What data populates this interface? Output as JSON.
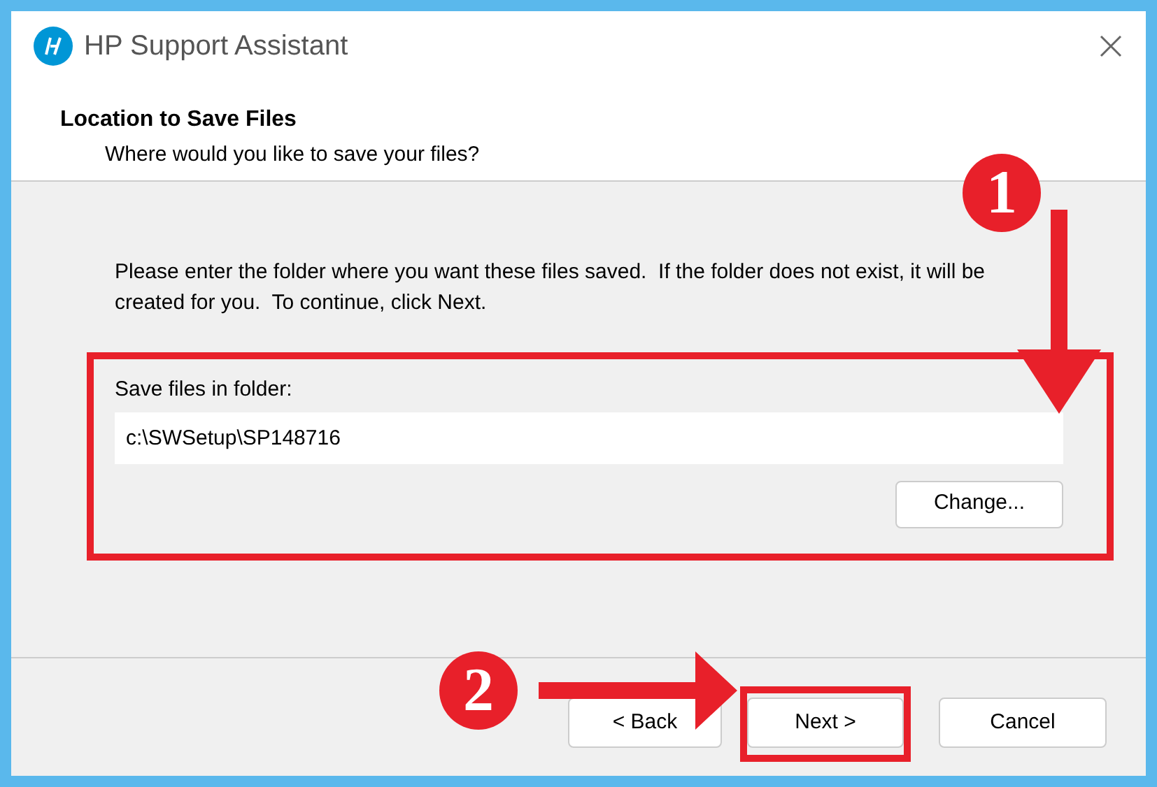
{
  "window": {
    "title": "HP Support Assistant"
  },
  "header": {
    "title": "Location to Save Files",
    "subtitle": "Where would you like to save your files?"
  },
  "instructions": "Please enter the folder where you want these files saved.  If the folder does not exist, it will be created for you.  To continue, click Next.",
  "folder": {
    "label": "Save files in folder:",
    "value": "c:\\SWSetup\\SP148716",
    "button": "Change..."
  },
  "buttons": [
    {
      "label": "< Back",
      "kind": "back"
    },
    {
      "label": "Next >",
      "kind": "next"
    },
    {
      "label": "Cancel",
      "kind": "cancel"
    }
  ],
  "annotations": [
    {
      "number": "1"
    },
    {
      "number": "2"
    }
  ]
}
